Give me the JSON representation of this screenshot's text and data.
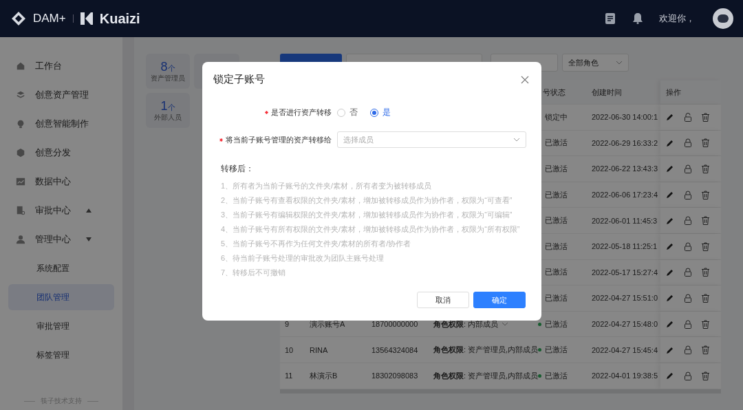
{
  "header": {
    "logo_text": "DAM+",
    "brand": "Kuaizi",
    "welcome": "欢迎你，"
  },
  "sidebar": {
    "items": [
      {
        "label": "工作台"
      },
      {
        "label": "创意资产管理"
      },
      {
        "label": "创意智能制作"
      },
      {
        "label": "创意分发"
      },
      {
        "label": "数据中心"
      },
      {
        "label": "审批中心",
        "expanded": false
      },
      {
        "label": "管理中心",
        "expanded": true,
        "children": [
          {
            "label": "系统配置",
            "selected": false
          },
          {
            "label": "团队管理",
            "selected": true
          },
          {
            "label": "审批管理",
            "selected": false
          },
          {
            "label": "标签管理",
            "selected": false
          }
        ]
      }
    ],
    "footer": "筷子技术支持"
  },
  "stats": [
    {
      "kind": "stat",
      "count": "8",
      "unit": "个",
      "label": "资产管理员"
    },
    {
      "kind": "empty"
    },
    {
      "kind": "stat",
      "count": "1",
      "unit": "个",
      "label": "外部人员"
    }
  ],
  "toolbar": {
    "role_filter": "全部角色"
  },
  "table": {
    "columns": {
      "status": "号状态",
      "created": "创建时间",
      "actions": "操作"
    },
    "rows": [
      {
        "status": "锁定中",
        "locked": true,
        "created": "2022-06-30 14:00:1"
      },
      {
        "status": "已激活",
        "locked": false,
        "created": "2022-06-29 16:33:2"
      },
      {
        "status": "已激活",
        "locked": false,
        "created": "2022-06-22 13:43:3"
      },
      {
        "status": "已激活",
        "locked": false,
        "created": "2022-06-06 17:23:4"
      },
      {
        "status": "已激活",
        "locked": false,
        "created": "2022-06-01 11:45:3"
      },
      {
        "status": "已激活",
        "locked": false,
        "created": "2022-05-18 11:25:1"
      },
      {
        "status": "已激活",
        "locked": false,
        "created": "2022-05-17 15:27:4"
      },
      {
        "status": "已激活",
        "locked": false,
        "created": "2022-04-27 15:51:0"
      },
      {
        "index": "9",
        "name": "演示账号A",
        "phone": "18700000000",
        "role": "**角色权限**: 内部成员",
        "status": "已激活",
        "locked": false,
        "created": "2022-04-27 15:48:0"
      },
      {
        "index": "10",
        "name": "RINA",
        "phone": "13564324084",
        "role": "**角色权限**: 资产管理员,内部成员",
        "status": "已激活",
        "locked": false,
        "created": "2022-04-27 15:45:4"
      },
      {
        "index": "11",
        "name": "林演示B",
        "phone": "18302098083",
        "role": "**角色权限**: 资产管理员,内部成员",
        "status": "已激活",
        "locked": false,
        "created": "2022-04-01 19:38:5"
      }
    ]
  },
  "dialog": {
    "title": "锁定子账号",
    "transfer": {
      "label": "是否进行资产转移",
      "required": true,
      "options": [
        {
          "label": "否",
          "selected": false
        },
        {
          "label": "是",
          "selected": true
        }
      ]
    },
    "target": {
      "label": "将当前子账号管理的资产转移给",
      "required": true,
      "placeholder": "选择成员"
    },
    "notes_title": "转移后：",
    "notes": [
      "1、所有者为当前子账号的文件夹/素材，所有者变为被转移成员",
      "2、当前子账号有查看权限的文件夹/素材，增加被转移成员作为协作者，权限为“可查看”",
      "3、当前子账号有编辑权限的文件夹/素材，增加被转移成员作为协作者，权限为“可编辑”",
      "4、当前子账号有所有权限的文件夹/素材，增加被转移成员作为协作者，权限为“所有权限”",
      "5、当前子账号不再作为任何文件夹/素材的所有者/协作者",
      "6、待当前子账号处理的审批改为团队主账号处理",
      "7、转移后不可撤销"
    ],
    "buttons": [
      {
        "label": "取消",
        "kind": "secondary"
      },
      {
        "label": "确定",
        "kind": "primary"
      }
    ]
  }
}
